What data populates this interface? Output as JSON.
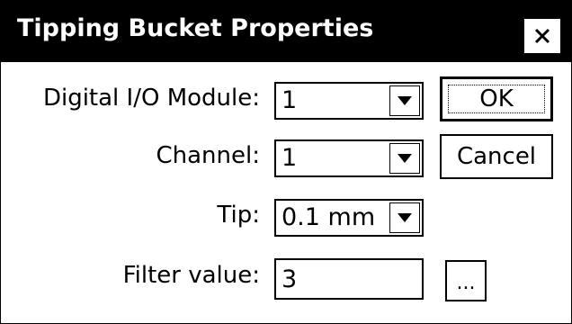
{
  "window": {
    "title": "Tipping Bucket Properties",
    "close_glyph": "×"
  },
  "form": {
    "digital_io_module": {
      "label": "Digital I/O Module:",
      "value": "1"
    },
    "channel": {
      "label": "Channel:",
      "value": "1"
    },
    "tip": {
      "label": "Tip:",
      "value": "0.1 mm"
    },
    "filter_value": {
      "label": "Filter value:",
      "value": "3",
      "browse_label": "..."
    }
  },
  "buttons": {
    "ok": "OK",
    "cancel": "Cancel"
  },
  "icons": {
    "close": "close-icon",
    "dropdown": "chevron-down-icon"
  },
  "colors": {
    "titlebar_bg": "#000000",
    "titlebar_text": "#ffffff",
    "background": "#ffffff",
    "border": "#000000"
  }
}
